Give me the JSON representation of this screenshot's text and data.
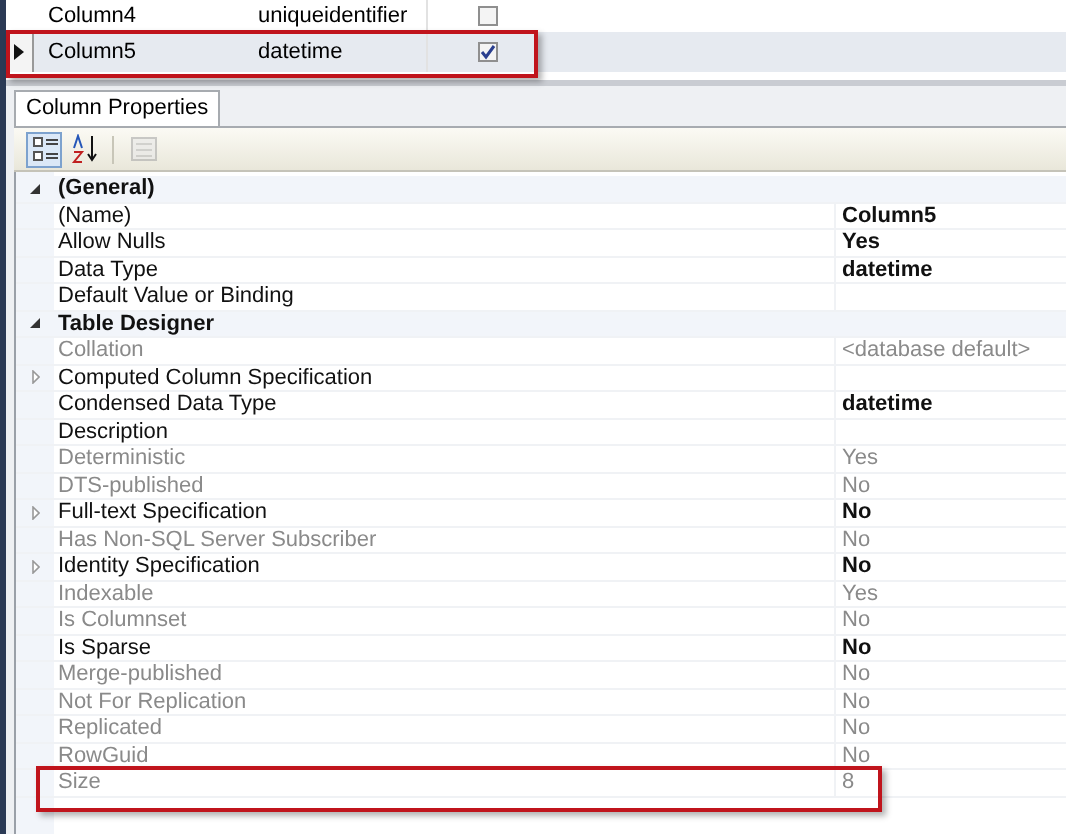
{
  "columns_grid": {
    "rows": [
      {
        "name": "Column4",
        "data_type": "uniqueidentifier",
        "allow_nulls": false,
        "selected": false,
        "highlighted": false
      },
      {
        "name": "Column5",
        "data_type": "datetime",
        "allow_nulls": true,
        "selected": true,
        "highlighted": true
      }
    ]
  },
  "properties_panel": {
    "tabs": [
      {
        "label": "Column Properties",
        "selected": true
      }
    ],
    "toolbar": [
      {
        "kind": "categorized",
        "selected": true,
        "disabled": false
      },
      {
        "kind": "alphabetical",
        "selected": false,
        "disabled": false
      },
      {
        "kind": "property_pages",
        "selected": false,
        "disabled": true
      }
    ],
    "rows": [
      {
        "kind": "category",
        "name": "(General)",
        "expanded": true
      },
      {
        "kind": "property",
        "name": "(Name)",
        "value": "Column5",
        "readonly": false,
        "expandable": false,
        "highlighted": false
      },
      {
        "kind": "property",
        "name": "Allow Nulls",
        "value": "Yes",
        "readonly": false,
        "expandable": false,
        "highlighted": false
      },
      {
        "kind": "property",
        "name": "Data Type",
        "value": "datetime",
        "readonly": false,
        "expandable": false,
        "highlighted": false
      },
      {
        "kind": "property",
        "name": "Default Value or Binding",
        "readonly": false,
        "expandable": false,
        "highlighted": false
      },
      {
        "kind": "category",
        "name": "Table Designer",
        "expanded": true
      },
      {
        "kind": "property",
        "name": "Collation",
        "value": "<database default>",
        "readonly": true,
        "expandable": false,
        "highlighted": false
      },
      {
        "kind": "property",
        "name": "Computed Column Specification",
        "readonly": false,
        "expandable": true,
        "highlighted": false
      },
      {
        "kind": "property",
        "name": "Condensed Data Type",
        "value": "datetime",
        "readonly": false,
        "expandable": false,
        "highlighted": false
      },
      {
        "kind": "property",
        "name": "Description",
        "readonly": false,
        "expandable": false,
        "highlighted": false
      },
      {
        "kind": "property",
        "name": "Deterministic",
        "value": "Yes",
        "readonly": true,
        "expandable": false,
        "highlighted": false
      },
      {
        "kind": "property",
        "name": "DTS-published",
        "value": "No",
        "readonly": true,
        "expandable": false,
        "highlighted": false
      },
      {
        "kind": "property",
        "name": "Full-text Specification",
        "value": "No",
        "readonly": false,
        "expandable": true,
        "highlighted": false
      },
      {
        "kind": "property",
        "name": "Has Non-SQL Server Subscriber",
        "value": "No",
        "readonly": true,
        "expandable": false,
        "highlighted": false
      },
      {
        "kind": "property",
        "name": "Identity Specification",
        "value": "No",
        "readonly": false,
        "expandable": true,
        "highlighted": false
      },
      {
        "kind": "property",
        "name": "Indexable",
        "value": "Yes",
        "readonly": true,
        "expandable": false,
        "highlighted": false
      },
      {
        "kind": "property",
        "name": "Is Columnset",
        "value": "No",
        "readonly": true,
        "expandable": false,
        "highlighted": false
      },
      {
        "kind": "property",
        "name": "Is Sparse",
        "value": "No",
        "readonly": false,
        "expandable": false,
        "highlighted": false
      },
      {
        "kind": "property",
        "name": "Merge-published",
        "value": "No",
        "readonly": true,
        "expandable": false,
        "highlighted": false
      },
      {
        "kind": "property",
        "name": "Not For Replication",
        "value": "No",
        "readonly": true,
        "expandable": false,
        "highlighted": false
      },
      {
        "kind": "property",
        "name": "Replicated",
        "value": "No",
        "readonly": true,
        "expandable": false,
        "highlighted": false
      },
      {
        "kind": "property",
        "name": "RowGuid",
        "value": "No",
        "readonly": true,
        "expandable": false,
        "highlighted": false
      },
      {
        "kind": "property",
        "name": "Size",
        "value": "8",
        "readonly": true,
        "expandable": false,
        "highlighted": true
      }
    ]
  }
}
